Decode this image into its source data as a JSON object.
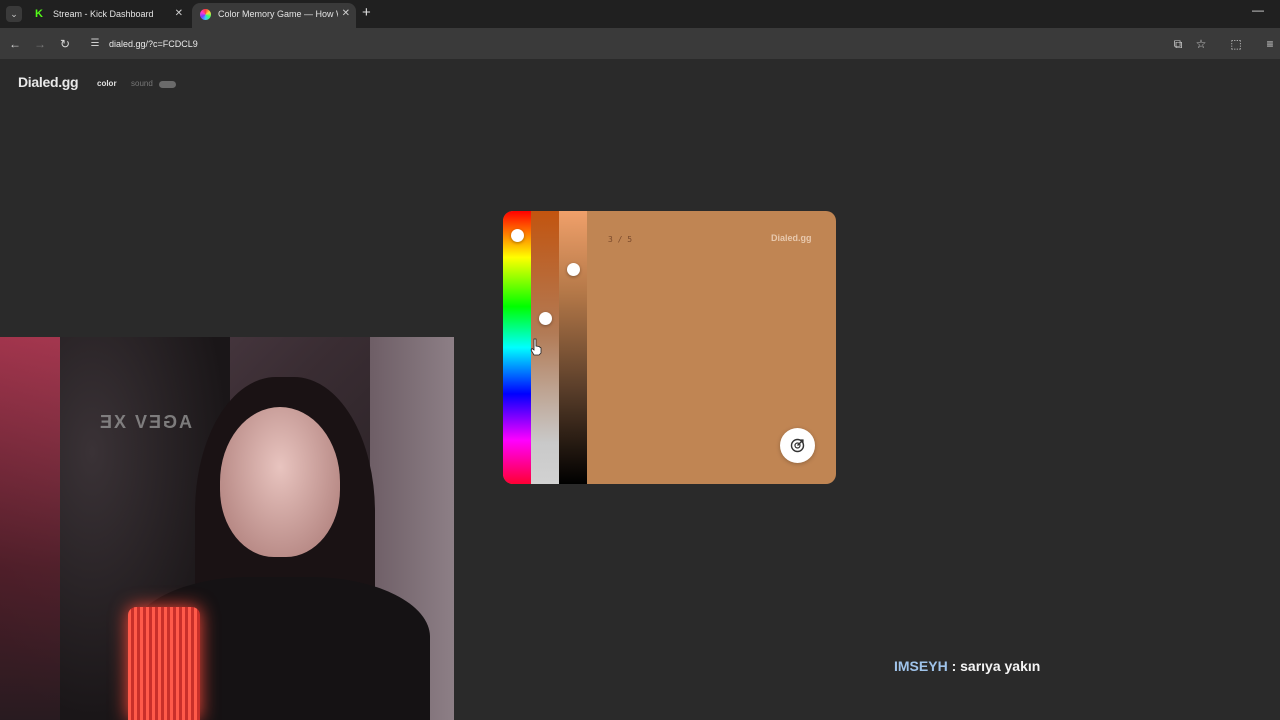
{
  "browser": {
    "tabs": [
      {
        "title": "Stream - Kick Dashboard",
        "active": false,
        "favicon": "kick-logo-icon"
      },
      {
        "title": "Color Memory Game — How W",
        "active": true,
        "favicon": "color-wheel-icon"
      }
    ],
    "address": "dialed.gg/?c=FCDCL9"
  },
  "site": {
    "logo": "Dialed.gg",
    "nav": {
      "color": "color",
      "sound": "sound"
    }
  },
  "game": {
    "counter": "3 / 5",
    "brand": "Dialed.gg",
    "card_color": "#c08553",
    "picker": {
      "hue_level": 0.07,
      "saturation_level": 0.39,
      "brightness_level": 0.2
    }
  },
  "webcam": {
    "chair_text": "AGEV XE"
  },
  "chat": {
    "user": "IMSEYH",
    "separator": " : ",
    "message": "sarıya yakın"
  }
}
